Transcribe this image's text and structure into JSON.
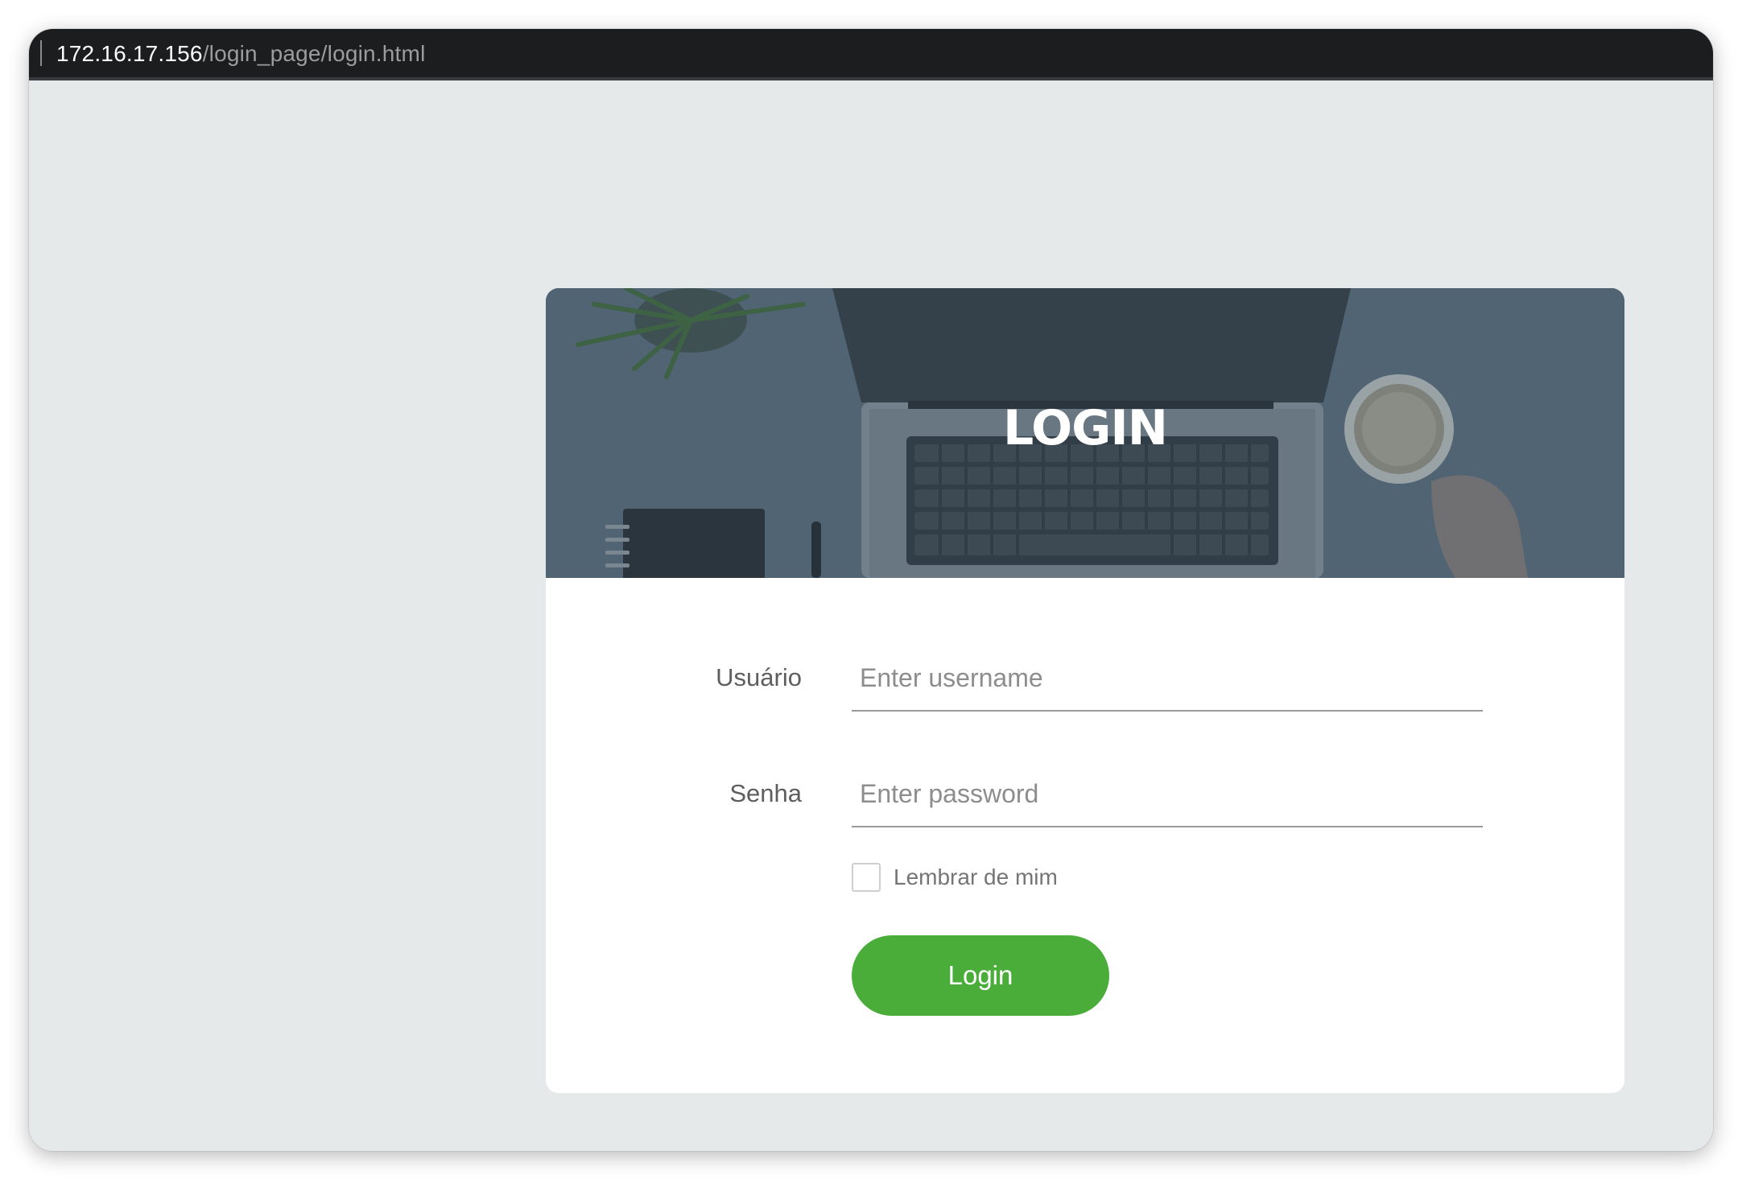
{
  "browser": {
    "url_host": "172.16.17.156",
    "url_path": "/login_page/login.html"
  },
  "login_card": {
    "hero_title": "LOGIN",
    "username": {
      "label": "Usuário",
      "placeholder": "Enter username",
      "value": ""
    },
    "password": {
      "label": "Senha",
      "placeholder": "Enter password",
      "value": ""
    },
    "remember_me": {
      "label": "Lembrar de mim",
      "checked": false
    },
    "submit_label": "Login"
  },
  "colors": {
    "page_background": "#e6e9ea",
    "hero_overlay": "#566a78",
    "button": "#4aad3a",
    "address_bar": "#1c1d1f"
  },
  "icons": {
    "checkbox": "checkbox-empty-icon"
  }
}
